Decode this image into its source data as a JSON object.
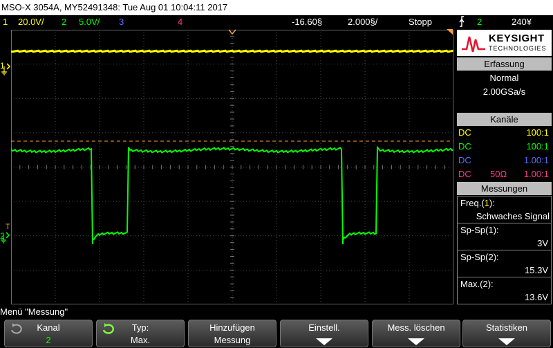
{
  "title": "MSO-X 3054A, MY52491348: Tue Aug 01 10:04:11 2017",
  "status": {
    "ch1_num": "1",
    "ch1_scale": "20.0V/",
    "ch2_num": "2",
    "ch2_scale": "5.0V/",
    "ch3_num": "3",
    "ch4_num": "4",
    "time_delay": "-16.60§",
    "time_scale": "2.000§/",
    "run_state": "Stopp",
    "trigger_icon": "trigger-edge-icon",
    "trigger_source": "2",
    "trigger_level": "240¥"
  },
  "markers": {
    "ch1": "1",
    "ch2": "2",
    "trigger": "T"
  },
  "brand": {
    "name": "KEYSIGHT",
    "sub": "TECHNOLOGIES"
  },
  "acq": {
    "header": "Erfassung",
    "mode": "Normal",
    "rate": "2.00GSa/s"
  },
  "channels": {
    "header": "Kanäle",
    "rows": [
      {
        "coupling": "DC",
        "imp": "",
        "probe": "100:1",
        "color": "#ffff00"
      },
      {
        "coupling": "DC",
        "imp": "",
        "probe": "100:1",
        "color": "#00ff00"
      },
      {
        "coupling": "DC",
        "imp": "",
        "probe": "1.00:1",
        "color": "#5a6dff"
      },
      {
        "coupling": "DC",
        "imp": "50Ω",
        "probe": "1.00:1",
        "color": "#ff3a8c"
      }
    ]
  },
  "meas": {
    "header": "Messungen",
    "freq_label": "Freq.(",
    "freq_ch": "1",
    "freq_close": "):",
    "freq_value": "Schwaches Signal",
    "spp1_label": "Sp-Sp(1):",
    "spp1_value": "3V",
    "spp2_label": "Sp-Sp(2):",
    "spp2_value": "15.3V",
    "max2_label": "Max.(2):",
    "max2_value": "13.6V"
  },
  "menu_title": "Menü \"Messung\"",
  "softkeys": [
    {
      "l1": "Kanal",
      "l2": "2"
    },
    {
      "l1": "Typ:",
      "l2": "Max."
    },
    {
      "l1": "Hinzufügen",
      "l2": "Messung"
    },
    {
      "l1": "Einstell.",
      "l2": ""
    },
    {
      "l1": "Mess. löschen",
      "l2": ""
    },
    {
      "l1": "Statistiken",
      "l2": ""
    }
  ],
  "colors": {
    "ch1": "#ffff00",
    "ch2": "#00ff00",
    "ch3": "#5a6dff",
    "ch4": "#ff3a8c",
    "trigger_level": "#ff9c3c"
  }
}
